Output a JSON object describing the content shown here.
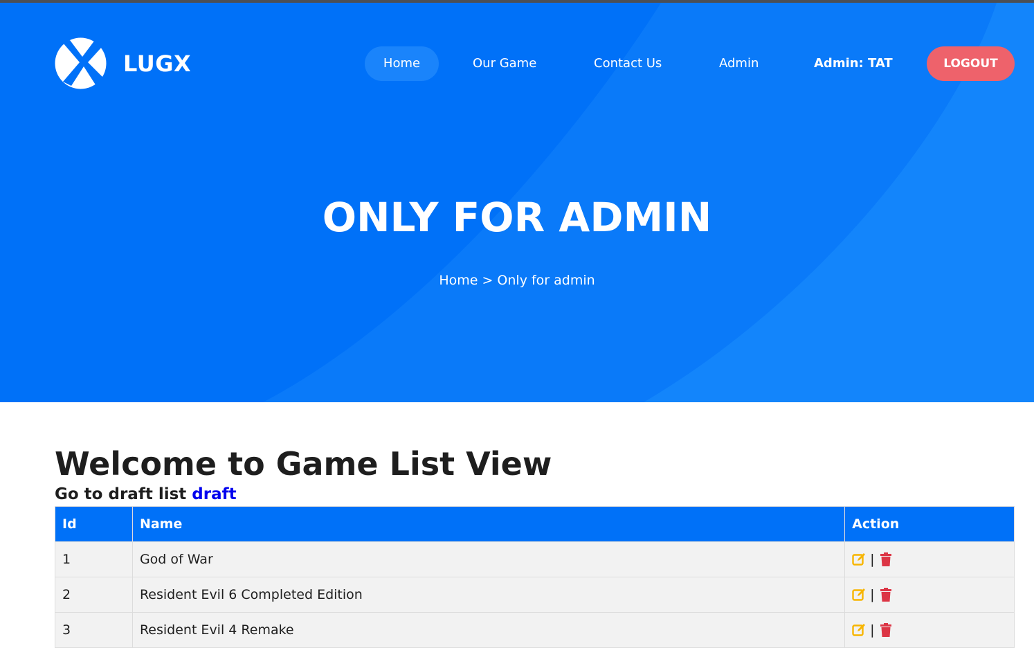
{
  "brand": {
    "name": "LUGX"
  },
  "nav": {
    "items": [
      {
        "label": "Home",
        "active": true
      },
      {
        "label": "Our Game",
        "active": false
      },
      {
        "label": "Contact Us",
        "active": false
      },
      {
        "label": "Admin",
        "active": false
      }
    ],
    "user_label": "Admin: TAT",
    "logout_label": "LOGOUT"
  },
  "hero": {
    "title": "ONLY FOR ADMIN",
    "breadcrumb": "Home > Only for admin"
  },
  "main": {
    "heading": "Welcome to Game List View",
    "draft_prefix": "Go to draft list",
    "draft_link": "draft"
  },
  "table": {
    "headers": {
      "id": "Id",
      "name": "Name",
      "action": "Action"
    },
    "action_separator": "|",
    "rows": [
      {
        "id": "1",
        "name": "God of War"
      },
      {
        "id": "2",
        "name": "Resident Evil 6 Completed Edition"
      },
      {
        "id": "3",
        "name": "Resident Evil 4 Remake"
      }
    ]
  },
  "colors": {
    "primary": "#0071f8",
    "accent": "#ee626b",
    "edit_icon": "#f7b500",
    "delete_icon": "#dc3545",
    "link": "#0000ee"
  },
  "icons": {
    "logo": "lugx-logo-icon",
    "edit": "edit-icon",
    "delete": "trash-icon"
  }
}
